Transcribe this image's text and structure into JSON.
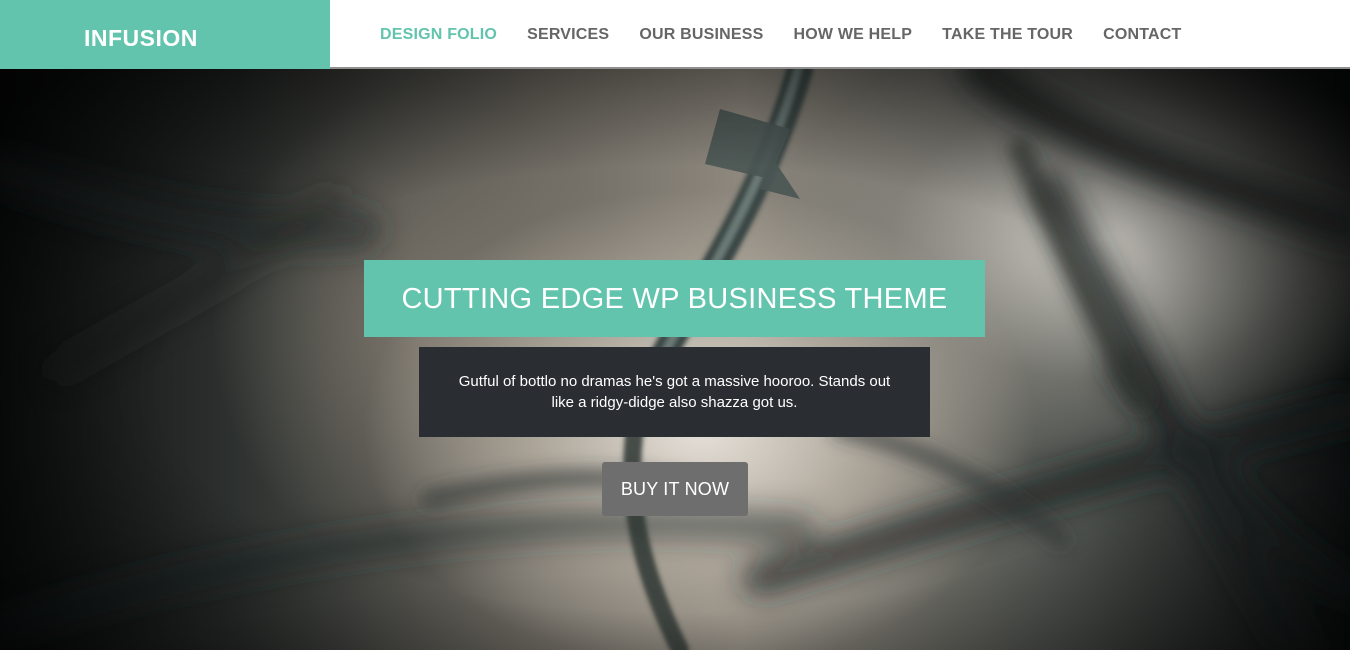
{
  "header": {
    "logo": "INFUSION",
    "nav": [
      {
        "label": "DESIGN FOLIO",
        "active": true
      },
      {
        "label": "SERVICES",
        "active": false
      },
      {
        "label": "OUR BUSINESS",
        "active": false
      },
      {
        "label": "HOW WE HELP",
        "active": false
      },
      {
        "label": "TAKE THE TOUR",
        "active": false
      },
      {
        "label": "CONTACT",
        "active": false
      }
    ]
  },
  "hero": {
    "title": "CUTTING EDGE WP BUSINESS THEME",
    "text": "Gutful of bottlo no dramas he's got a massive hooroo. Stands out like a ridgy-didge also shazza got us.",
    "button_label": "BUY IT NOW"
  },
  "colors": {
    "accent": "#62c4ad",
    "dark_box": "#2a2d32",
    "button": "#6e6e6e",
    "nav_text": "#666666"
  }
}
